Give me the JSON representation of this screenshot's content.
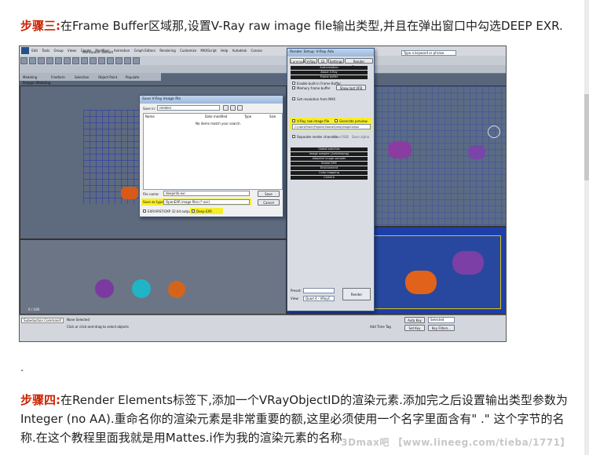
{
  "step3": {
    "label": "步骤三:",
    "text": "在Frame Buffer区域那,设置V-Ray raw image file输出类型,并且在弹出窗口中勾选DEEP EXR."
  },
  "step4": {
    "label": "步骤四:",
    "text": "在Render Elements标签下,添加一个VRayObjectID的渲染元素.添加完之后设置输出类型参数为Integer (no AA).重命名你的渲染元素是非常重要的额,这里必须使用一个名字里面含有\" .\" 这个字节的名称.在这个教程里面我就是用Mattes.i作为我的渲染元素的名称"
  },
  "separator_dot": ".",
  "watermark": "3Dmax吧 【www.lineeg.com/tieba/1771】",
  "screenshot": {
    "title": "Workspace: Default",
    "search_placeholder": "Type a keyword or phrase",
    "menu": [
      "Edit",
      "Tools",
      "Group",
      "Views",
      "Create",
      "Modifiers",
      "Animation",
      "Graph Editors",
      "Rendering",
      "Customize",
      "MAXScript",
      "Help",
      "Autodesk",
      "Corona"
    ],
    "ribbon_tabs": [
      "Modeling",
      "Freeform",
      "Selection",
      "Object Paint",
      "Populate"
    ],
    "ribbon_sub": "Polygon Modeling",
    "timeline": "0 / 100",
    "status_left": "None Selected",
    "status_hint": "Click or click-and-drag to select objects",
    "maxscript_listener": "Subeduction Command!",
    "add_time_tag": "Add Time Tag",
    "auto_key": "Auto Key",
    "set_key": "Set Key",
    "selected": "Selected",
    "key_filters": "Key Filters...",
    "save_dialog": {
      "title": "Save V-Ray image file",
      "save_in_label": "Save in:",
      "save_in_value": "renders",
      "columns": [
        "Name",
        "Date modified",
        "Type",
        "Size"
      ],
      "empty_text": "No items match your search.",
      "file_name_label": "File name:",
      "file_name_value": "deepinfo.exr",
      "save_as_type_label": "Save as type:",
      "save_as_type_value": "OpenEXR image files (*.exr)",
      "save_button": "Save",
      "cancel_button": "Cancel",
      "opt1": "EXR/VRST/OXP 32 bit output",
      "opt2": "Deep EXR"
    },
    "render_setup": {
      "title": "Render Setup: V-Ray Adv",
      "tabs": [
        "Common",
        "V-Ray",
        "GI",
        "Settings",
        "Render Elements"
      ],
      "rollouts_top": [
        "Authorization",
        "About V-Ray",
        "Frame buffer"
      ],
      "fb_options": [
        "Enable built-in Frame Buffer",
        "Memory frame buffer",
        "Show last VFB"
      ],
      "get_res": "Get resolution from MAX",
      "raw_image_label": "V-Ray raw image file",
      "generate_preview": "Generate preview",
      "raw_path": "C:\\Users\\Public\\Projects\\Tutorial\\Deep\\ImageCompo",
      "separate_channels": "Separate render channels",
      "save_rgb": "Save RGB",
      "save_alpha": "Save alpha",
      "rollouts_bottom": [
        "Global switches",
        "Image sampler (Antialiasing)",
        "Adaptive image sampler",
        "Global DMC",
        "Environment",
        "Color mapping",
        "Camera"
      ],
      "preset_label": "Preset:",
      "view_label": "View:",
      "view_value": "Quad 4 - VRayC",
      "render_button": "Render"
    }
  }
}
